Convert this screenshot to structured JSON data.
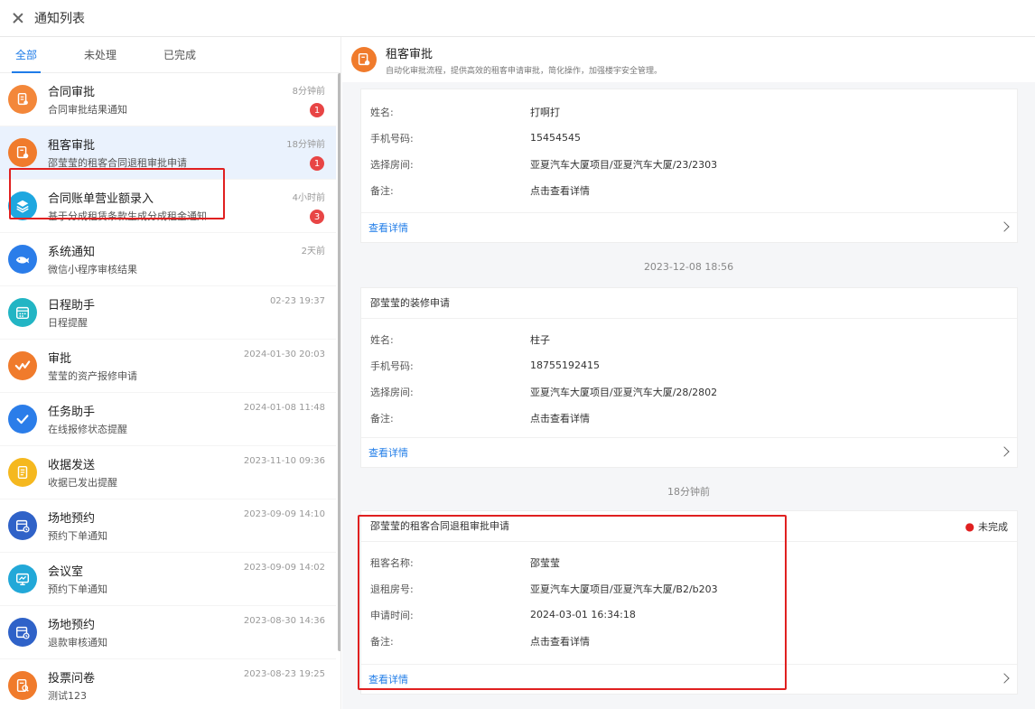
{
  "window": {
    "title": "通知列表"
  },
  "tabs": [
    "全部",
    "未处理",
    "已完成"
  ],
  "notifications": [
    {
      "name": "合同审批",
      "sub": "合同审批结果通知",
      "time": "8分钟前",
      "badge": "1",
      "color": "#f3873a",
      "icon": "document-icon"
    },
    {
      "name": "租客审批",
      "sub": "邵莹莹的租客合同退租审批申请",
      "time": "18分钟前",
      "badge": "1",
      "color": "#f07b2c",
      "icon": "tenant-icon"
    },
    {
      "name": "合同账单营业额录入",
      "sub": "基于分成租赁条款生成分成租金通知",
      "time": "4小时前",
      "badge": "3",
      "color": "#1ea7e0",
      "icon": "layers-icon"
    },
    {
      "name": "系统通知",
      "sub": "微信小程序审核结果",
      "time": "2天前",
      "badge": "",
      "color": "#2b7de9",
      "icon": "whale-icon"
    },
    {
      "name": "日程助手",
      "sub": "日程提醒",
      "time": "02-23 19:37",
      "badge": "",
      "color": "#22b5c4",
      "icon": "calendar-icon"
    },
    {
      "name": "审批",
      "sub": "莹莹的资产报修申请",
      "time": "2024-01-30 20:03",
      "badge": "",
      "color": "#f07b2c",
      "icon": "approval-icon"
    },
    {
      "name": "任务助手",
      "sub": "在线报修状态提醒",
      "time": "2024-01-08 11:48",
      "badge": "",
      "color": "#2b7de9",
      "icon": "check-icon"
    },
    {
      "name": "收据发送",
      "sub": "收据已发出提醒",
      "time": "2023-11-10 09:36",
      "badge": "",
      "color": "#f5b81f",
      "icon": "receipt-icon"
    },
    {
      "name": "场地预约",
      "sub": "预约下单通知",
      "time": "2023-09-09 14:10",
      "badge": "",
      "color": "#2f62c8",
      "icon": "venue-icon"
    },
    {
      "name": "会议室",
      "sub": "预约下单通知",
      "time": "2023-09-09 14:02",
      "badge": "",
      "color": "#22a8d8",
      "icon": "meeting-icon"
    },
    {
      "name": "场地预约",
      "sub": "退款审核通知",
      "time": "2023-08-30 14:36",
      "badge": "",
      "color": "#2f62c8",
      "icon": "venue-icon"
    },
    {
      "name": "投票问卷",
      "sub": "测试123",
      "time": "2023-08-23 19:25",
      "badge": "",
      "color": "#f07b2c",
      "icon": "survey-icon"
    }
  ],
  "detail": {
    "title": "租客审批",
    "subtitle": "自动化审批流程，提供高效的租客申请审批，简化操作，加强楼宇安全管理。",
    "cards": [
      {
        "title": "",
        "status": "",
        "rows": [
          {
            "k": "姓名:",
            "v": "打啊打"
          },
          {
            "k": "手机号码:",
            "v": "15454545"
          },
          {
            "k": "选择房间:",
            "v": "亚夏汽车大厦项目/亚夏汽车大厦/23/2303"
          },
          {
            "k": "备注:",
            "v": "点击查看详情"
          }
        ],
        "more": "查看详情"
      },
      {
        "stamp": "2023-12-08 18:56",
        "title": "邵莹莹的装修申请",
        "status": "",
        "rows": [
          {
            "k": "姓名:",
            "v": "柱子"
          },
          {
            "k": "手机号码:",
            "v": "18755192415"
          },
          {
            "k": "选择房间:",
            "v": "亚夏汽车大厦项目/亚夏汽车大厦/28/2802"
          },
          {
            "k": "备注:",
            "v": "点击查看详情"
          }
        ],
        "more": "查看详情"
      },
      {
        "stamp": "18分钟前",
        "title": "邵莹莹的租客合同退租审批申请",
        "status": "未完成",
        "rows": [
          {
            "k": "租客名称:",
            "v": "邵莹莹"
          },
          {
            "k": "退租房号:",
            "v": "亚夏汽车大厦项目/亚夏汽车大厦/B2/b203"
          },
          {
            "k": "申请时间:",
            "v": "2024-03-01 16:34:18"
          },
          {
            "k": "备注:",
            "v": "点击查看详情"
          }
        ],
        "more": "查看详情"
      }
    ]
  }
}
